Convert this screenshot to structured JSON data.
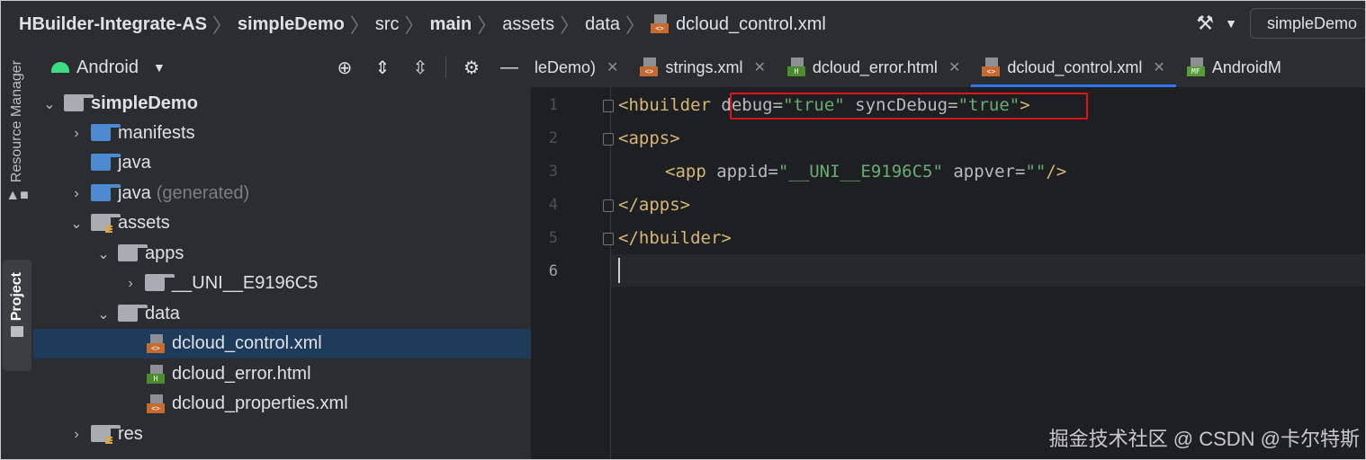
{
  "breadcrumb": {
    "items": [
      "HBuilder-Integrate-AS",
      "simpleDemo",
      "src",
      "main",
      "assets",
      "data"
    ],
    "file": "dcloud_control.xml"
  },
  "toolbar": {
    "run_config": "simpleDemo",
    "hammer_icon": "hammer-icon"
  },
  "side_stripe": {
    "resource_manager": "Resource Manager",
    "project": "Project"
  },
  "project_panel": {
    "view_mode": "Android",
    "tree": [
      {
        "label": "simpleDemo",
        "expanded": true
      },
      {
        "label": "manifests",
        "expanded": false
      },
      {
        "label": "java"
      },
      {
        "label": "java",
        "suffix": "(generated)",
        "expanded": false
      },
      {
        "label": "assets",
        "expanded": true
      },
      {
        "label": "apps",
        "expanded": true
      },
      {
        "label": "__UNI__E9196C5",
        "expanded": false
      },
      {
        "label": "data",
        "expanded": true
      },
      {
        "label": "dcloud_control.xml",
        "selected": true
      },
      {
        "label": "dcloud_error.html"
      },
      {
        "label": "dcloud_properties.xml"
      },
      {
        "label": "res",
        "expanded": false
      }
    ]
  },
  "editor": {
    "tabs": [
      {
        "label": "leDemo)"
      },
      {
        "label": "strings.xml"
      },
      {
        "label": "dcloud_error.html"
      },
      {
        "label": "dcloud_control.xml",
        "active": true
      },
      {
        "label": "AndroidM"
      }
    ],
    "line_numbers": [
      "1",
      "2",
      "3",
      "4",
      "5",
      "6"
    ],
    "code": {
      "l1_open": "<hbuilder",
      "l1_attr1": "debug",
      "l1_eq1": "=",
      "l1_val1": "\"true\"",
      "l1_attr2": "syncDebug",
      "l1_eq2": "=",
      "l1_val2": "\"true\"",
      "l1_close": ">",
      "l2": "<apps>",
      "l3_open": "<app",
      "l3_attr1": "appid",
      "l3_eq1": "=",
      "l3_val1": "\"__UNI__E9196C5\"",
      "l3_attr2": "appver",
      "l3_eq2": "=",
      "l3_val2": "\"\"",
      "l3_close": "/>",
      "l4": "</apps>",
      "l5": "</hbuilder>"
    },
    "highlight_color": "#e0151b"
  },
  "watermark": "掘金技术社区 @ CSDN @卡尔特斯"
}
